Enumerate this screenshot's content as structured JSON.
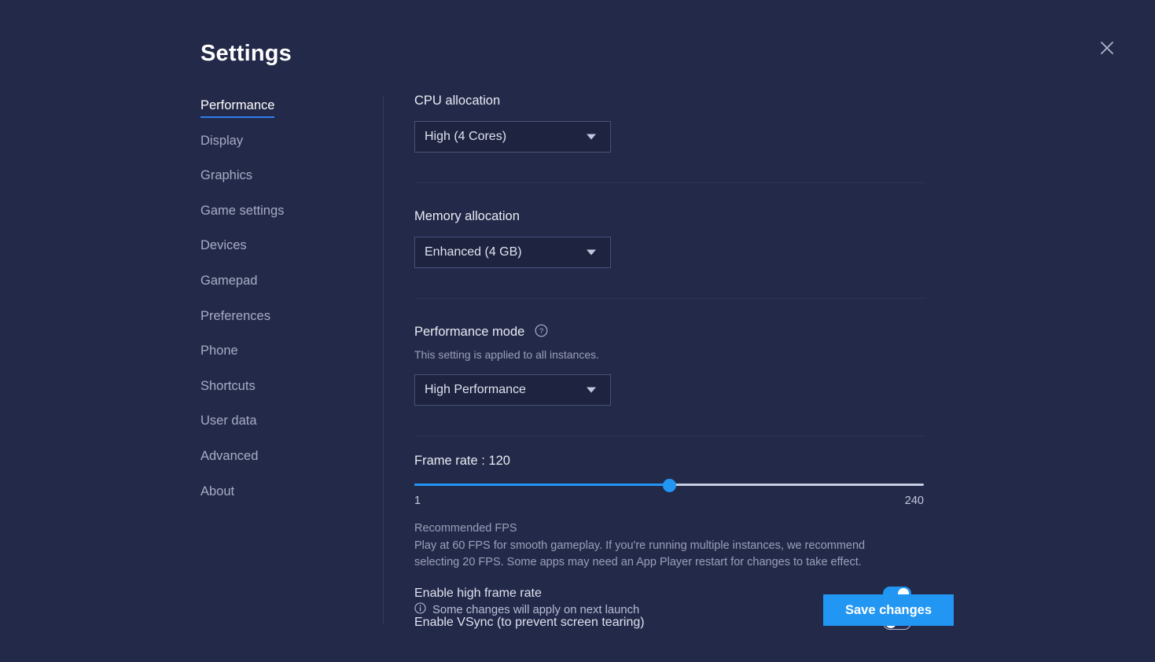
{
  "window": {
    "title": "Settings",
    "close_icon": "close-icon"
  },
  "sidebar": {
    "items": [
      {
        "label": "Performance",
        "active": true
      },
      {
        "label": "Display",
        "active": false
      },
      {
        "label": "Graphics",
        "active": false
      },
      {
        "label": "Game settings",
        "active": false
      },
      {
        "label": "Devices",
        "active": false
      },
      {
        "label": "Gamepad",
        "active": false
      },
      {
        "label": "Preferences",
        "active": false
      },
      {
        "label": "Phone",
        "active": false
      },
      {
        "label": "Shortcuts",
        "active": false
      },
      {
        "label": "User data",
        "active": false
      },
      {
        "label": "Advanced",
        "active": false
      },
      {
        "label": "About",
        "active": false
      }
    ]
  },
  "main": {
    "cpu": {
      "label": "CPU allocation",
      "value": "High (4 Cores)",
      "caret_icon": "chevron-down-icon"
    },
    "memory": {
      "label": "Memory allocation",
      "value": "Enhanced (4 GB)",
      "caret_icon": "chevron-down-icon"
    },
    "performance_mode": {
      "label": "Performance mode",
      "help_icon": "help-circle-icon",
      "subtitle": "This setting is applied to all instances.",
      "value": "High Performance",
      "caret_icon": "chevron-down-icon"
    },
    "frame_rate": {
      "label": "Frame rate : 120",
      "value": 120,
      "min_label": "1",
      "max_label": "240",
      "min": 1,
      "max": 240,
      "percent": "50%",
      "note_title": "Recommended FPS",
      "note_body": "Play at 60 FPS for smooth gameplay. If you're running multiple instances, we recommend selecting 20 FPS. Some apps may need an App Player restart for changes to take effect."
    },
    "toggles": [
      {
        "label": "Enable high frame rate",
        "state": "on"
      },
      {
        "label": "Enable VSync (to prevent screen tearing)",
        "state": "off"
      }
    ]
  },
  "footer": {
    "info_icon": "info-circle-icon",
    "note": "Some changes will apply on next launch",
    "save_label": "Save changes"
  },
  "colors": {
    "background": "#232949",
    "accent": "#2196f3",
    "active_underline": "#2f80ed",
    "text_primary": "#e8eaf2",
    "text_muted": "#9aa0b8",
    "field_bg": "#1e2340",
    "field_border": "#4a5178"
  }
}
